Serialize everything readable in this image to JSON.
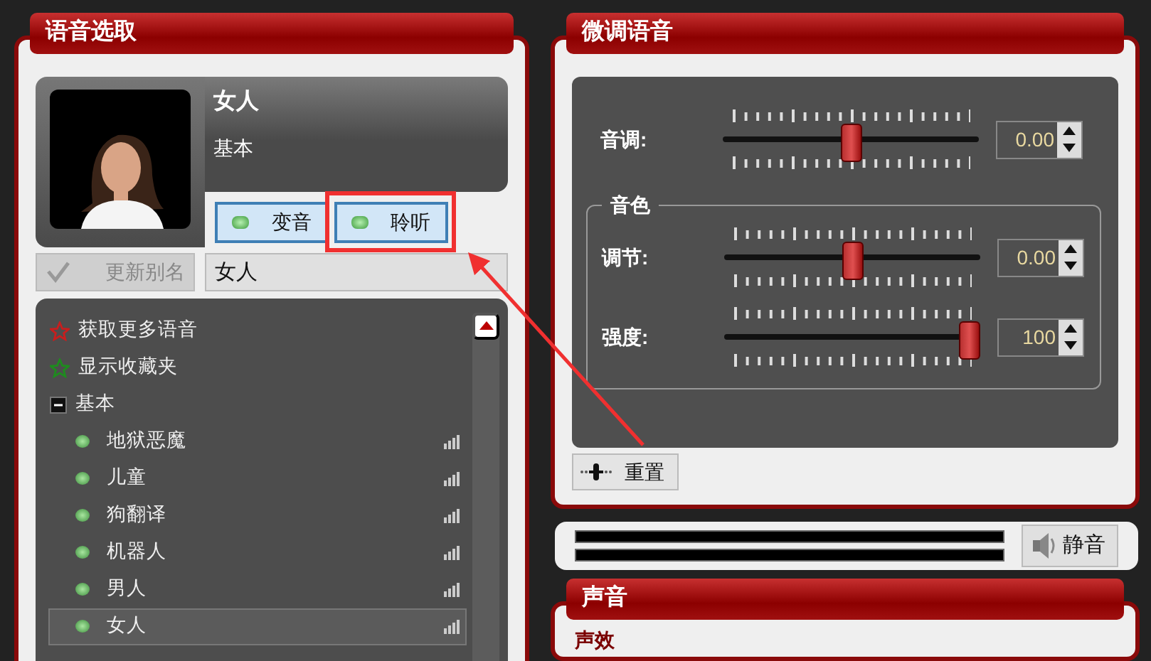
{
  "voice_selection": {
    "title": "语音选取",
    "current": {
      "name": "女人",
      "category": "基本"
    },
    "buttons": [
      {
        "label": "变音"
      },
      {
        "label": "聆听"
      }
    ],
    "alias": {
      "button": "更新别名",
      "disabled": true,
      "value": "女人"
    },
    "list": [
      {
        "kind": "action",
        "label": "获取更多语音",
        "color": "#c81e1e"
      },
      {
        "kind": "action",
        "label": "显示收藏夹",
        "color": "#1e8c1e"
      },
      {
        "kind": "group",
        "label": "基本",
        "expanded": true,
        "children": [
          {
            "label": "地狱恶魔",
            "selected": false
          },
          {
            "label": "儿童",
            "selected": false
          },
          {
            "label": "狗翻译",
            "selected": false
          },
          {
            "label": "机器人",
            "selected": false
          },
          {
            "label": "男人",
            "selected": false
          },
          {
            "label": "女人",
            "selected": true
          }
        ]
      }
    ]
  },
  "fine_tune": {
    "title": "微调语音",
    "sliders": [
      {
        "label": "音调:",
        "level": 0.5,
        "value": "0.00"
      }
    ],
    "timbre": {
      "title": "音色",
      "sliders": [
        {
          "label": "调节:",
          "level": 0.5,
          "value": "0.00"
        },
        {
          "label": "强度:",
          "level": 1,
          "value": "100"
        }
      ]
    },
    "reset_button": "重置"
  },
  "output": {
    "mute_button": "静音"
  },
  "sound": {
    "title": "声音",
    "effects": {
      "title": "声效"
    }
  }
}
